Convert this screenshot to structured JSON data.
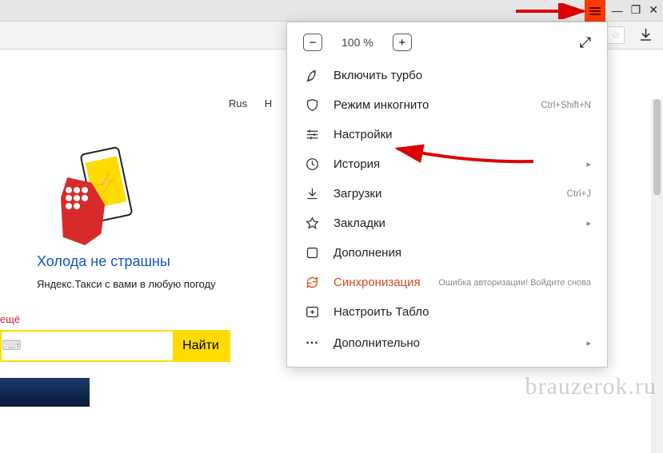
{
  "titlebar": {
    "minimize": "—",
    "maximize": "❐",
    "close": "✕"
  },
  "page": {
    "lang_rus": "Rus",
    "lang_h": "H",
    "promo_title": "Холода не страшны",
    "promo_sub": "Яндекс.Такси с вами в любую погоду",
    "more": "ещё",
    "search_btn": "Найти"
  },
  "menu": {
    "zoom_label": "100 %",
    "turbo": "Включить турбо",
    "incognito": "Режим инкогнито",
    "incognito_sc": "Ctrl+Shift+N",
    "settings": "Настройки",
    "history": "История",
    "downloads": "Загрузки",
    "downloads_sc": "Ctrl+J",
    "bookmarks": "Закладки",
    "addons": "Дополнения",
    "sync": "Синхронизация",
    "sync_err": "Ошибка авторизации! Войдите снова",
    "tableau": "Настроить Табло",
    "more": "Дополнительно"
  },
  "watermark": "brauzerok.ru"
}
